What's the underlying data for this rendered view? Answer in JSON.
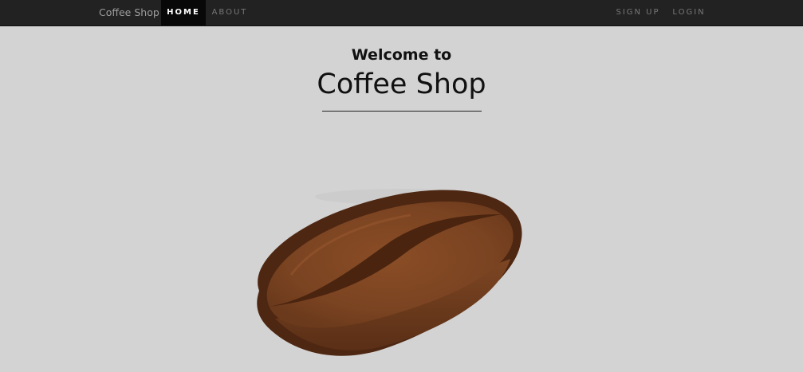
{
  "navbar": {
    "brand": "Coffee Shop",
    "items_left": [
      {
        "label": "HOME",
        "active": true
      },
      {
        "label": "ABOUT",
        "active": false
      }
    ],
    "items_right": [
      {
        "label": "SIGN UP"
      },
      {
        "label": "LOGIN"
      }
    ]
  },
  "hero": {
    "welcome": "Welcome to",
    "title": "Coffee Shop",
    "image_icon": "coffee-bean-image"
  },
  "colors": {
    "navbar_bg": "#222222",
    "active_item_bg": "#080808",
    "page_bg": "#d3d3d3",
    "bean_outer": "#4e2712",
    "bean_inner": "#7a4321"
  }
}
